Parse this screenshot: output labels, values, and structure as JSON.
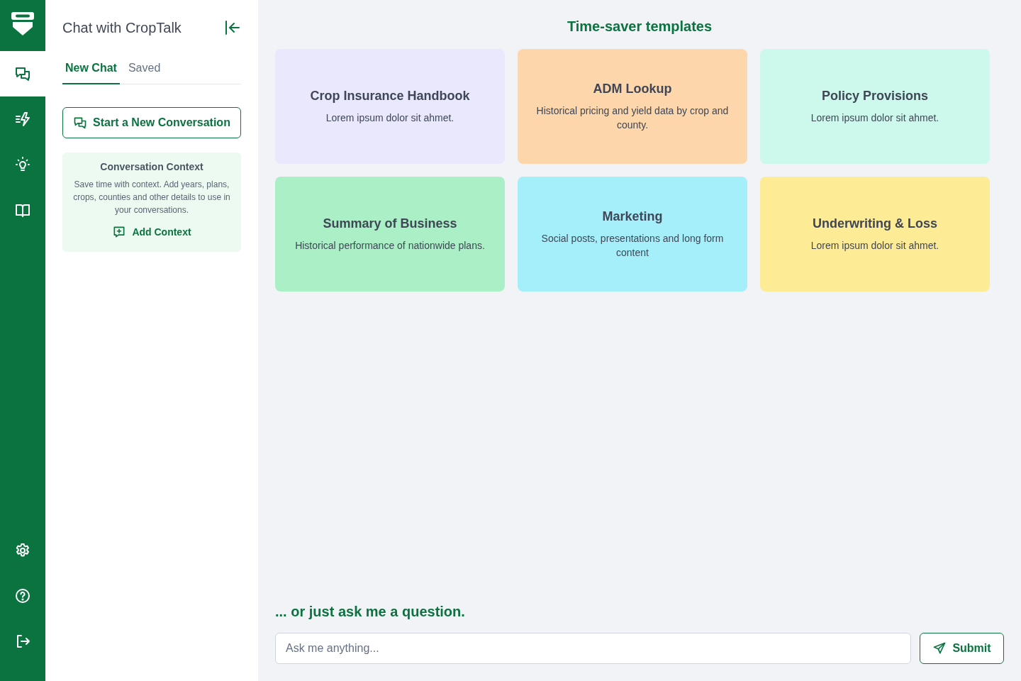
{
  "rail": {
    "top": [
      {
        "kind": "chat",
        "selected": true
      },
      {
        "kind": "lightning",
        "selected": false
      },
      {
        "kind": "bulb",
        "selected": false
      },
      {
        "kind": "book",
        "selected": false
      }
    ],
    "bottom": [
      {
        "kind": "settings",
        "selected": false
      },
      {
        "kind": "help",
        "selected": false
      },
      {
        "kind": "logout",
        "selected": false
      }
    ]
  },
  "sidebar": {
    "title": "Chat with CropTalk",
    "tabs": [
      {
        "label": "New Chat",
        "selected": true
      },
      {
        "label": "Saved",
        "selected": false
      }
    ],
    "new_conversation_button": "Start a New Conversation",
    "context_card": {
      "title": "Conversation Context",
      "description": "Save time with context. Add years, plans, crops, counties and other details to use in your conversations.",
      "button": "Add Context"
    }
  },
  "templates": {
    "heading": "Time-saver templates",
    "cards": [
      {
        "title": "Crop Insurance Handbook",
        "description": "Lorem ipsum dolor sit ahmet.",
        "color": "#e9e8fd"
      },
      {
        "title": "ADM Lookup",
        "description": "Historical pricing and yield data by crop and county.",
        "color": "#fed6ab"
      },
      {
        "title": "Policy Provisions",
        "description": "Lorem ipsum dolor sit ahmet.",
        "color": "#cdf8ec"
      },
      {
        "title": "Summary of Business",
        "description": "Historical performance of nationwide plans.",
        "color": "#abefc6"
      },
      {
        "title": "Marketing",
        "description": "Social posts, presentations and long form content",
        "color": "#a5effb"
      },
      {
        "title": "Underwriting & Loss",
        "description": "Lorem ipsum dolor sit ahmet.",
        "color": "#feeb96"
      }
    ]
  },
  "ask": {
    "heading": "... or just ask me a question.",
    "placeholder": "Ask me anything...",
    "submit": "Submit"
  }
}
